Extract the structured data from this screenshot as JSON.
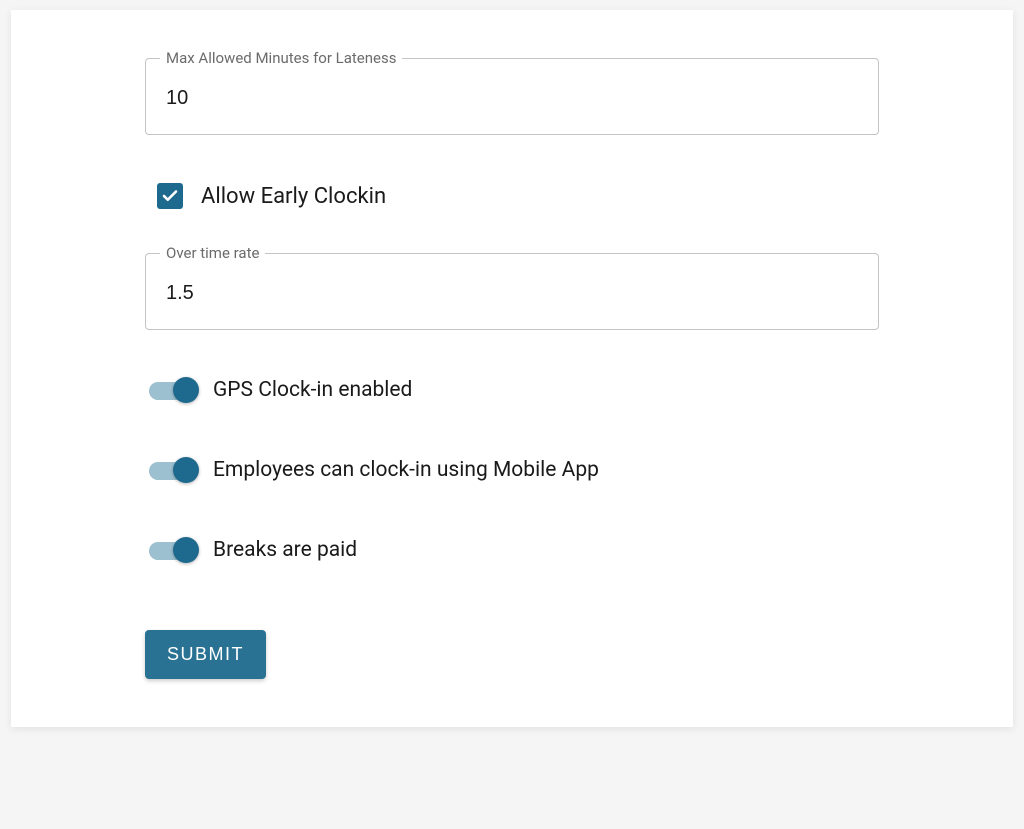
{
  "fields": {
    "lateness": {
      "label": "Max Allowed Minutes for Lateness",
      "value": "10"
    },
    "overtime": {
      "label": "Over time rate",
      "value": "1.5"
    }
  },
  "checkbox": {
    "early_clockin": {
      "label": "Allow Early Clockin",
      "checked": true
    }
  },
  "toggles": {
    "gps": {
      "label": "GPS Clock-in enabled",
      "checked": true
    },
    "mobile": {
      "label": "Employees can clock-in using Mobile App",
      "checked": true
    },
    "breaks": {
      "label": "Breaks are paid",
      "checked": true
    }
  },
  "buttons": {
    "submit": "SUBMIT"
  }
}
